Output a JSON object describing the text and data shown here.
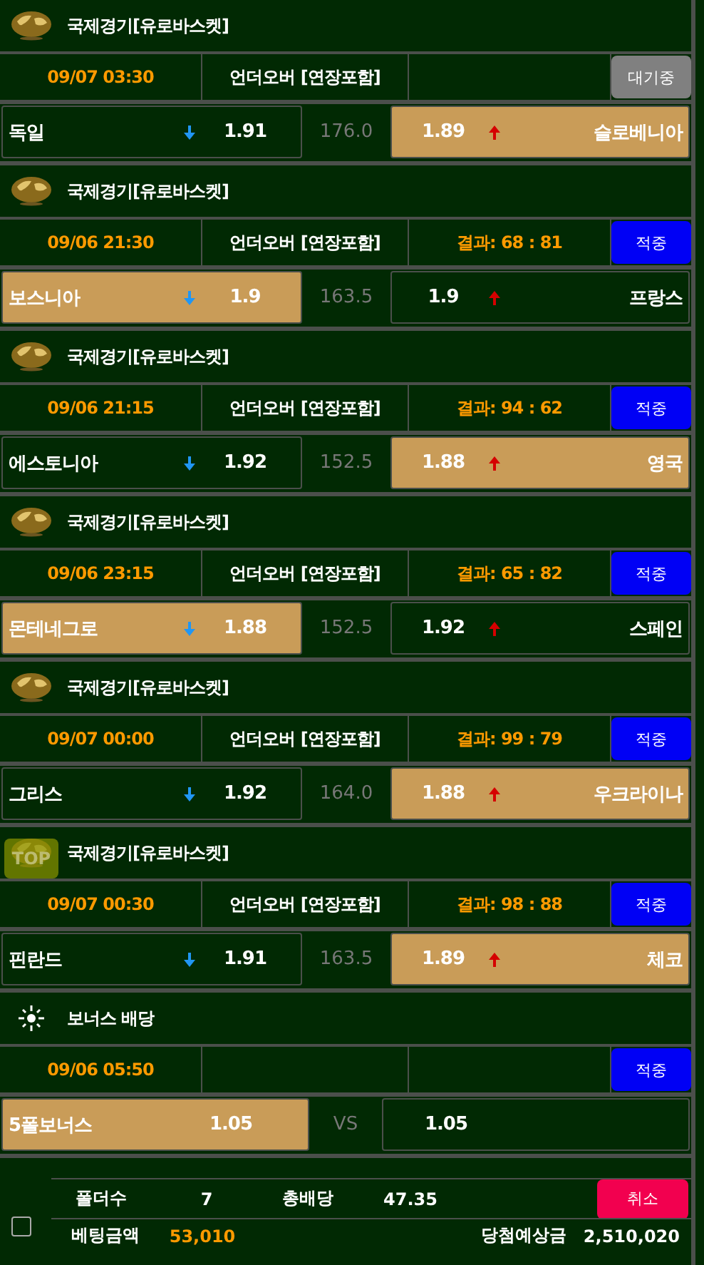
{
  "matches": [
    {
      "kind": "over_under",
      "league": "국제경기[유로바스켓]",
      "time": "09/07 03:30",
      "market": "언더오버 [연장포함]",
      "status": {
        "label": "대기중",
        "kind": "pending"
      },
      "home": {
        "team": "독일",
        "odds": "1.91",
        "selected": false
      },
      "line": "176.0",
      "away": {
        "team": "슬로베니아",
        "odds": "1.89",
        "selected": true
      }
    },
    {
      "kind": "over_under",
      "league": "국제경기[유로바스켓]",
      "time": "09/06 21:30",
      "market": "언더오버 [연장포함]",
      "result": "결과: 68 : 81",
      "status": {
        "label": "적중",
        "kind": "hit"
      },
      "home": {
        "team": "보스니아",
        "odds": "1.9",
        "selected": true
      },
      "line": "163.5",
      "away": {
        "team": "프랑스",
        "odds": "1.9",
        "selected": false
      }
    },
    {
      "kind": "over_under",
      "league": "국제경기[유로바스켓]",
      "time": "09/06 21:15",
      "market": "언더오버 [연장포함]",
      "result": "결과: 94 : 62",
      "status": {
        "label": "적중",
        "kind": "hit"
      },
      "home": {
        "team": "에스토니아",
        "odds": "1.92",
        "selected": false
      },
      "line": "152.5",
      "away": {
        "team": "영국",
        "odds": "1.88",
        "selected": true
      }
    },
    {
      "kind": "over_under",
      "league": "국제경기[유로바스켓]",
      "time": "09/06 23:15",
      "market": "언더오버 [연장포함]",
      "result": "결과: 65 : 82",
      "status": {
        "label": "적중",
        "kind": "hit"
      },
      "home": {
        "team": "몬테네그로",
        "odds": "1.88",
        "selected": true
      },
      "line": "152.5",
      "away": {
        "team": "스페인",
        "odds": "1.92",
        "selected": false
      }
    },
    {
      "kind": "over_under",
      "league": "국제경기[유로바스켓]",
      "time": "09/07 00:00",
      "market": "언더오버 [연장포함]",
      "result": "결과: 99 : 79",
      "status": {
        "label": "적중",
        "kind": "hit"
      },
      "home": {
        "team": "그리스",
        "odds": "1.92",
        "selected": false
      },
      "line": "164.0",
      "away": {
        "team": "우크라이나",
        "odds": "1.88",
        "selected": true
      }
    },
    {
      "kind": "over_under",
      "league": "국제경기[유로바스켓]",
      "time": "09/07 00:30",
      "market": "언더오버 [연장포함]",
      "result": "결과: 98 : 88",
      "top_button": "TOP",
      "status": {
        "label": "적중",
        "kind": "hit"
      },
      "home": {
        "team": "핀란드",
        "odds": "1.91",
        "selected": false
      },
      "line": "163.5",
      "away": {
        "team": "체코",
        "odds": "1.89",
        "selected": true
      }
    },
    {
      "kind": "bonus",
      "league": "보너스 배당",
      "time": "09/06 05:50",
      "status": {
        "label": "적중",
        "kind": "hit"
      },
      "home": {
        "team": "5폴보너스",
        "odds": "1.05",
        "selected": true
      },
      "line": "VS",
      "away": {
        "odds": "1.05",
        "selected": false
      }
    }
  ],
  "summary": {
    "checked": false,
    "folders_label": "폴더수",
    "folders": "7",
    "total_odds_label": "총배당",
    "total_odds": "47.35",
    "cancel": "취소",
    "stake_label": "베팅금액",
    "stake": "53,010",
    "payout_label": "당첨예상금",
    "payout": "2,510,020"
  }
}
